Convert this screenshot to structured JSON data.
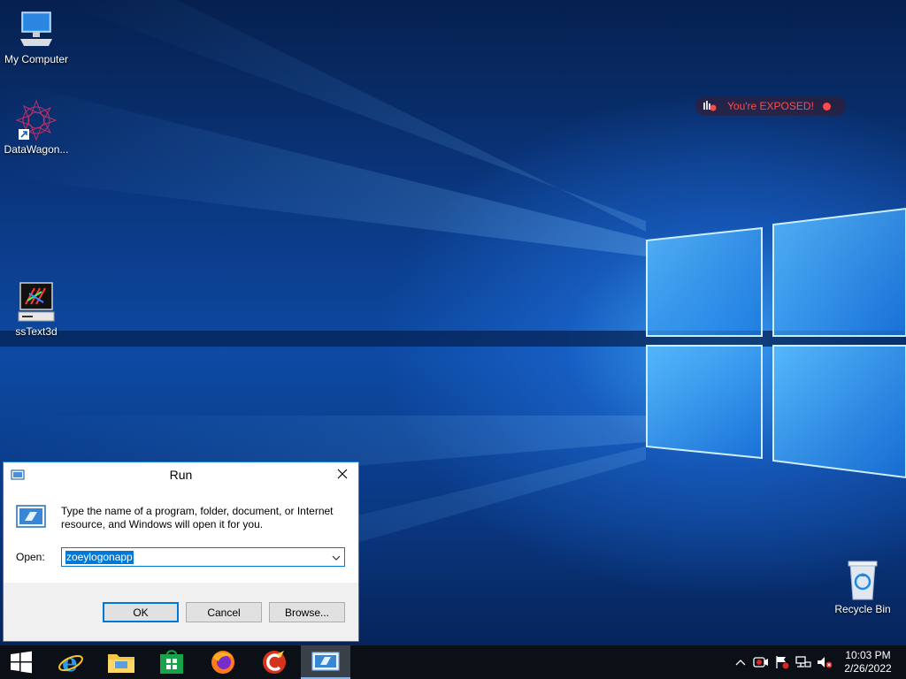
{
  "desktop": {
    "icons": [
      {
        "label": "My Computer"
      },
      {
        "label": "DataWagon..."
      },
      {
        "label": "ssText3d"
      },
      {
        "label": "Recycle Bin"
      }
    ]
  },
  "exposed_widget": {
    "text": "You're EXPOSED!",
    "color": "#ff4a4a"
  },
  "run_dialog": {
    "title": "Run",
    "description": "Type the name of a program, folder, document, or Internet resource, and Windows will open it for you.",
    "open_label": "Open:",
    "open_value": "zoeylogonapp",
    "ok_label": "OK",
    "cancel_label": "Cancel",
    "browse_label": "Browse...",
    "accent": "#0078d7"
  },
  "taskbar": {
    "items": [
      {
        "icon": "windows-start-icon"
      },
      {
        "icon": "internet-explorer-icon"
      },
      {
        "icon": "file-explorer-icon"
      },
      {
        "icon": "microsoft-store-icon"
      },
      {
        "icon": "firefox-icon"
      },
      {
        "icon": "ccleaner-icon"
      },
      {
        "icon": "run-icon",
        "active": true
      }
    ],
    "tray": [
      "chevron-up-icon",
      "recorder-icon",
      "flag-icon",
      "network-icon",
      "volume-muted-icon"
    ],
    "time": "10:03 PM",
    "date": "2/26/2022"
  }
}
